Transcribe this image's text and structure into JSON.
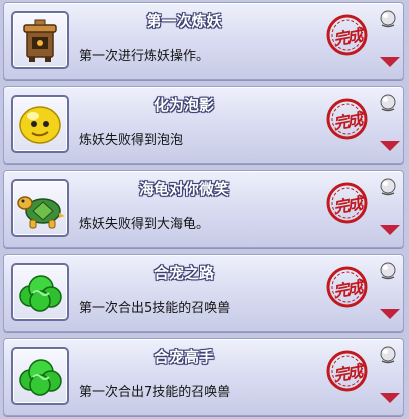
{
  "achievements": [
    {
      "title": "第一次炼妖",
      "description": "第一次进行炼妖操作。",
      "icon": "alchemy-furnace-icon",
      "status_stamp": "完成"
    },
    {
      "title": "化为泡影",
      "description": "炼妖失败得到泡泡",
      "icon": "yellow-bubble-icon",
      "status_stamp": "完成"
    },
    {
      "title": "海龟对你微笑",
      "description": "炼妖失败得到大海龟。",
      "icon": "sea-turtle-icon",
      "status_stamp": "完成"
    },
    {
      "title": "合宠之路",
      "description": "第一次合出5技能的召唤兽",
      "icon": "green-cloud-icon",
      "status_stamp": "完成"
    },
    {
      "title": "合宠高手",
      "description": "第一次合出7技能的召唤兽",
      "icon": "green-cloud-icon",
      "status_stamp": "完成"
    }
  ],
  "colors": {
    "stamp_red": "#c0191e",
    "arrow_red": "#c2233a",
    "title_outline": "#3b3f73"
  }
}
